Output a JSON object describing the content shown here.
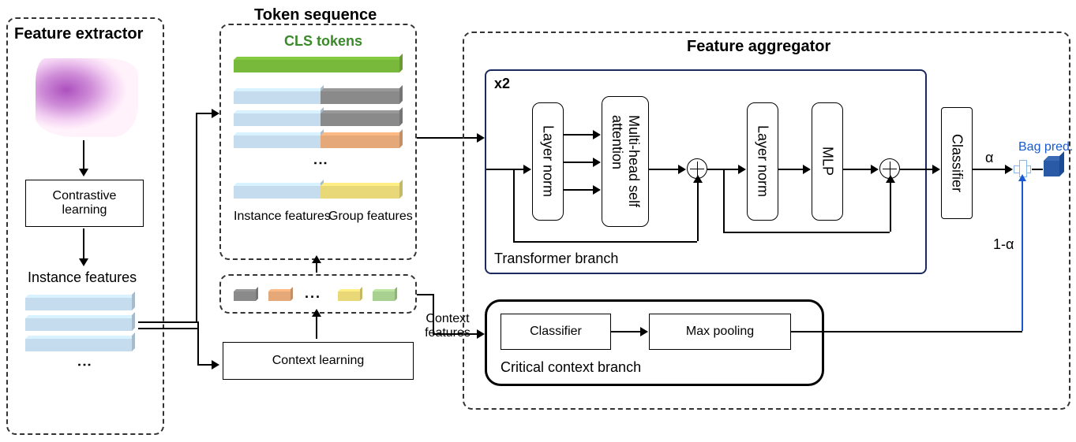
{
  "panels": {
    "feature_extractor": "Feature extractor",
    "token_sequence": "Token sequence",
    "feature_aggregator": "Feature aggregator"
  },
  "labels": {
    "cls_tokens": "CLS tokens",
    "instance_features_caption": "Instance features",
    "group_features_caption": "Group features",
    "instance_features": "Instance features",
    "context_features": "Context features",
    "bag_pred": "Bag pred.",
    "alpha": "α",
    "one_minus_alpha": "1-α",
    "transformer_multiplier": "x2",
    "transformer_branch": "Transformer branch",
    "critical_context_branch": "Critical context branch"
  },
  "boxes": {
    "contrastive_learning": "Contrastive\nlearning",
    "context_learning": "Context learning",
    "layer_norm_1": "Layer norm",
    "multihead": "Multi-head self\nattention",
    "layer_norm_2": "Layer norm",
    "mlp": "MLP",
    "classifier_top": "Classifier",
    "classifier_bottom": "Classifier",
    "max_pooling": "Max pooling"
  },
  "colors": {
    "cls_green": "#78b83a",
    "instance_blue": "#c5dcef",
    "group_gray": "#8a8a8a",
    "group_orange": "#e5a878",
    "group_yellow": "#e8d878",
    "small_green": "#a8d090"
  },
  "chart_data": {
    "type": "diagram",
    "components": [
      {
        "name": "Feature extractor",
        "contains": [
          "Histology image",
          "Contrastive learning",
          "Instance features"
        ]
      },
      {
        "name": "Token sequence",
        "contains": [
          "CLS tokens",
          "Instance features + Group features concatenated tokens"
        ]
      },
      {
        "name": "Context learning",
        "input": "Instance features",
        "output": "Context features / Group features"
      },
      {
        "name": "Feature aggregator",
        "contains": [
          "Transformer branch",
          "Critical context branch"
        ]
      },
      {
        "name": "Transformer branch",
        "repeat": 2,
        "sequence": [
          "Layer norm",
          "Multi-head self attention",
          "residual add",
          "Layer norm",
          "MLP",
          "residual add"
        ],
        "followed_by": "Classifier",
        "output_weight": "α"
      },
      {
        "name": "Critical context branch",
        "sequence": [
          "Classifier",
          "Max pooling"
        ],
        "output_weight": "1-α"
      },
      {
        "name": "Fusion",
        "op": "weighted sum (α, 1-α)",
        "output": "Bag pred."
      }
    ]
  }
}
